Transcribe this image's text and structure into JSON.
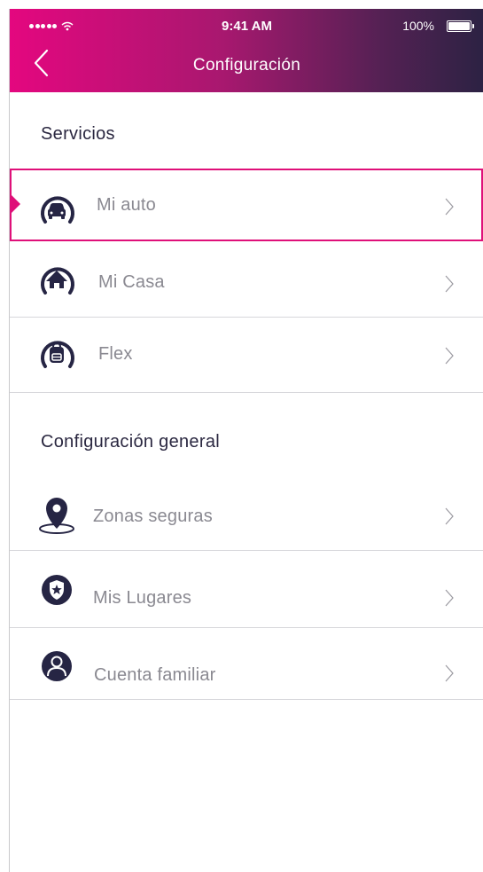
{
  "status_bar": {
    "time": "9:41 AM",
    "battery": "100%"
  },
  "nav": {
    "title": "Configuración"
  },
  "servicios": {
    "heading": "Servicios",
    "items": [
      {
        "label": "Mi auto",
        "icon": "car-icon",
        "selected": true
      },
      {
        "label": "Mi Casa",
        "icon": "house-icon",
        "selected": false
      },
      {
        "label": "Flex",
        "icon": "backpack-icon",
        "selected": false
      }
    ]
  },
  "general": {
    "heading": "Configuración general",
    "items": [
      {
        "label": "Zonas seguras",
        "icon": "location-pin-icon"
      },
      {
        "label": "Mis Lugares",
        "icon": "shield-star-icon"
      },
      {
        "label": "Cuenta familiar",
        "icon": "user-icon"
      }
    ]
  },
  "colors": {
    "accent": "#e4077f",
    "gradient_end": "#2c2243",
    "icon_dark": "#262544",
    "label_gray": "#8a8991"
  }
}
